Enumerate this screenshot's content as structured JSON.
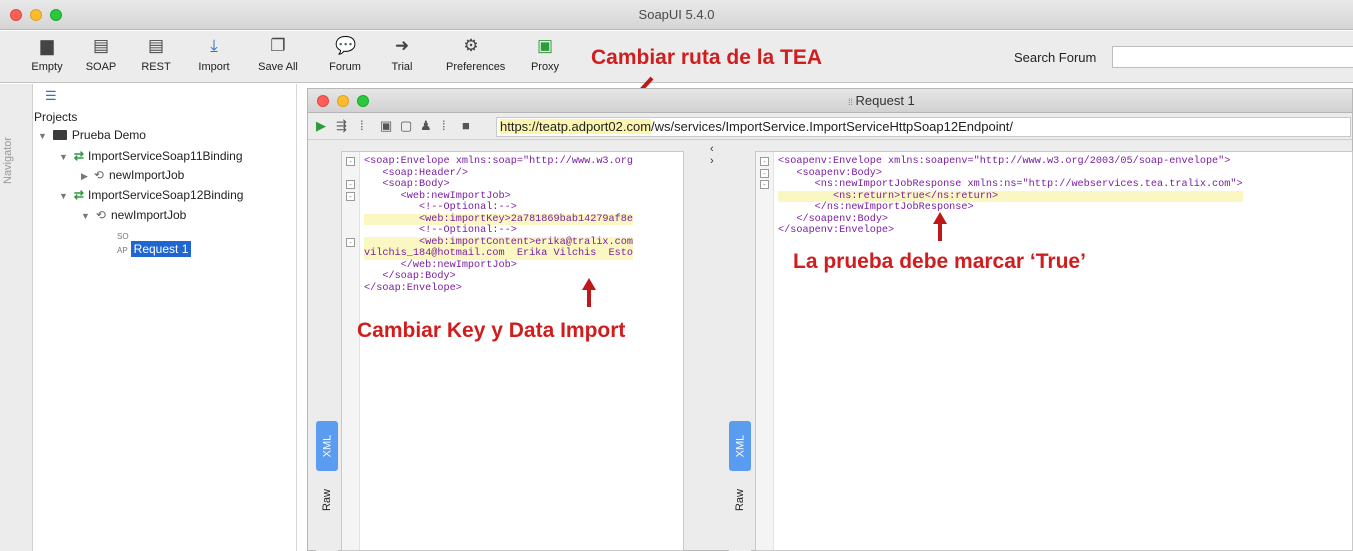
{
  "window": {
    "title": "SoapUI 5.4.0"
  },
  "toolbar": {
    "items": [
      {
        "label": "Empty",
        "icon": "empty-project-icon",
        "glyph": "▆"
      },
      {
        "label": "SOAP",
        "icon": "soap-project-icon",
        "glyph": "▤"
      },
      {
        "label": "REST",
        "icon": "rest-project-icon",
        "glyph": "▤"
      },
      {
        "label": "Import",
        "icon": "import-icon",
        "glyph": "⤓"
      },
      {
        "label": "Save All",
        "icon": "save-all-icon",
        "glyph": "❐"
      },
      {
        "label": "Forum",
        "icon": "forum-icon",
        "glyph": "💬"
      },
      {
        "label": "Trial",
        "icon": "trial-icon",
        "glyph": "➜"
      },
      {
        "label": "Preferences",
        "icon": "gear-icon",
        "glyph": "⚙"
      },
      {
        "label": "Proxy",
        "icon": "proxy-icon",
        "glyph": "▣"
      }
    ],
    "search_label": "Search Forum",
    "search_placeholder": ""
  },
  "navigator": {
    "side_label": "Navigator",
    "projects_label": "Projects",
    "tree": {
      "project": "Prueba Demo",
      "binding1": "ImportServiceSoap11Binding",
      "op1": "newImportJob",
      "binding2": "ImportServiceSoap12Binding",
      "op2": "newImportJob",
      "request": "Request 1"
    }
  },
  "request_window": {
    "title": "Request 1",
    "url_highlight": "https://teatp.adport02.com",
    "url_rest": "/ws/services/ImportService.ImportServiceHttpSoap12Endpoint/",
    "request_xml": [
      "<soap:Envelope xmlns:soap=\"http://www.w3.org",
      "   <soap:Header/>",
      "   <soap:Body>",
      "      <web:newImportJob>",
      "         <!--Optional:-->",
      "         <web:importKey>2a781869bab14279af8e",
      "         <!--Optional:-->",
      "         <web:importContent>erika@tralix.com",
      "vilchis_184@hotmail.com  Erika Vilchis  Esto",
      "      </web:newImportJob>",
      "   </soap:Body>",
      "</soap:Envelope>"
    ],
    "response_xml": [
      "<soapenv:Envelope xmlns:soapenv=\"http://www.w3.org/2003/05/soap-envelope\">",
      "   <soapenv:Body>",
      "      <ns:newImportJobResponse xmlns:ns=\"http://webservices.tea.tralix.com\">",
      "         <ns:return>true</ns:return>",
      "      </ns:newImportJobResponse>",
      "   </soapenv:Body>",
      "</soapenv:Envelope>"
    ],
    "tab_xml": "XML",
    "tab_raw": "Raw"
  },
  "annotations": {
    "url": "Cambiar ruta de la TEA",
    "key": "Cambiar Key y Data Import",
    "true": "La prueba debe marcar ‘True’"
  },
  "colors": {
    "annotation": "#d01d1d",
    "selection": "#1f66d1",
    "xml_tag": "#7a1fa2"
  }
}
